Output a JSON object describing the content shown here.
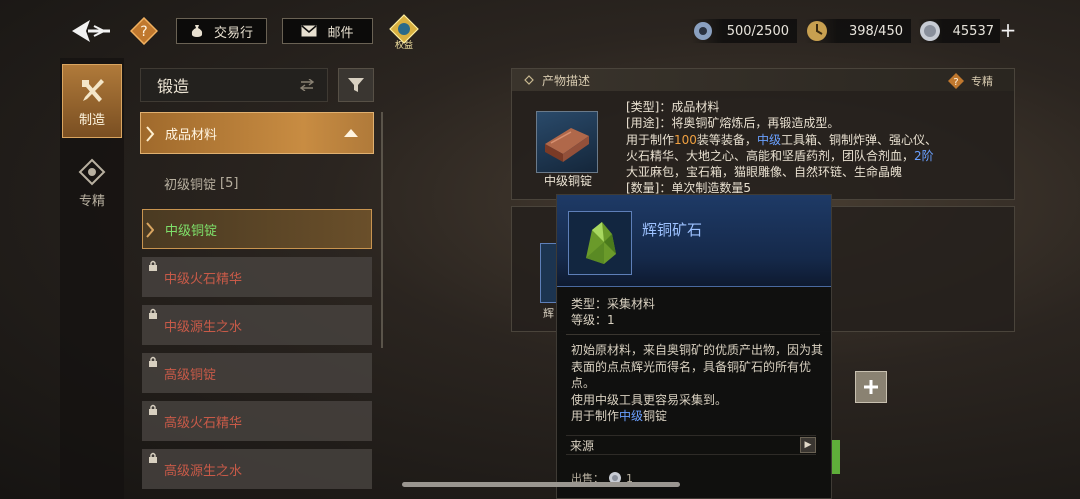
{
  "topbar": {
    "help_label": "?",
    "trade_button": "交易行",
    "mail_button": "邮件",
    "rights_label": "权益",
    "resources": [
      {
        "icon": "gear-icon",
        "value": "500/2500"
      },
      {
        "icon": "stamina-icon",
        "value": "398/450"
      },
      {
        "icon": "silver-coin-icon",
        "value": "45537"
      }
    ],
    "add_symbol": "+"
  },
  "rail": {
    "items": [
      {
        "label": "制造",
        "icon": "hammer-icon",
        "active": true
      },
      {
        "label": "专精",
        "icon": "specialty-icon",
        "active": false
      }
    ]
  },
  "category": {
    "selected": "锻造"
  },
  "list": {
    "header": "成品材料",
    "items": [
      {
        "label": "初级铜锭",
        "count": "[5]",
        "state": "plain"
      },
      {
        "label": "中级铜锭",
        "count": "",
        "state": "selected"
      },
      {
        "label": "中级火石精华",
        "count": "",
        "state": "locked"
      },
      {
        "label": "中级源生之水",
        "count": "",
        "state": "locked"
      },
      {
        "label": "高级铜锭",
        "count": "",
        "state": "locked"
      },
      {
        "label": "高级火石精华",
        "count": "",
        "state": "locked"
      },
      {
        "label": "高级源生之水",
        "count": "",
        "state": "locked"
      }
    ]
  },
  "description": {
    "header": "产物描述",
    "exclusive_label": "专精",
    "item_name": "中级铜锭",
    "type_line": "[类型]：成品材料",
    "use_line": "[用途]：将奥铜矿熔炼后，再锻造成型。",
    "line3_pre": "用于制作",
    "line3_num": "100",
    "line3_mid": "装等装备，",
    "line3_hl": "中级",
    "line3_post": "工具箱、铜制炸弹、强心仪、",
    "line4_pre": "火石精华、大地之心、高能和坚盾药剂，团队合剂血，",
    "line4_hl": "2阶",
    "line5": "大亚麻包，宝石箱，猫眼雕像、自然环链、生命晶魄",
    "qty_line": "[数量]：单次制造数量5"
  },
  "material_panel": {
    "item_label_partial": "辉"
  },
  "tooltip": {
    "title": "辉铜矿石",
    "type_line": "类型：采集材料",
    "level_line": "等级：1",
    "desc": "初始原材料，来自奥铜矿的优质产出物，因为其表面的点点辉光而得名，具备铜矿石的所有优点。",
    "desc2": "使用中级工具更容易采集到。",
    "use_pre": "用于制作",
    "use_hl": "中级",
    "use_post": "铜锭",
    "source_label": "来源",
    "sell_label": "出售：",
    "sell_value": "1"
  },
  "colors": {
    "accent_gold": "#c88c42",
    "selected_green": "#7ee06a",
    "locked_red": "#c85a48",
    "highlight_blue": "#6aa0ff",
    "highlight_orange": "#f0a040"
  }
}
